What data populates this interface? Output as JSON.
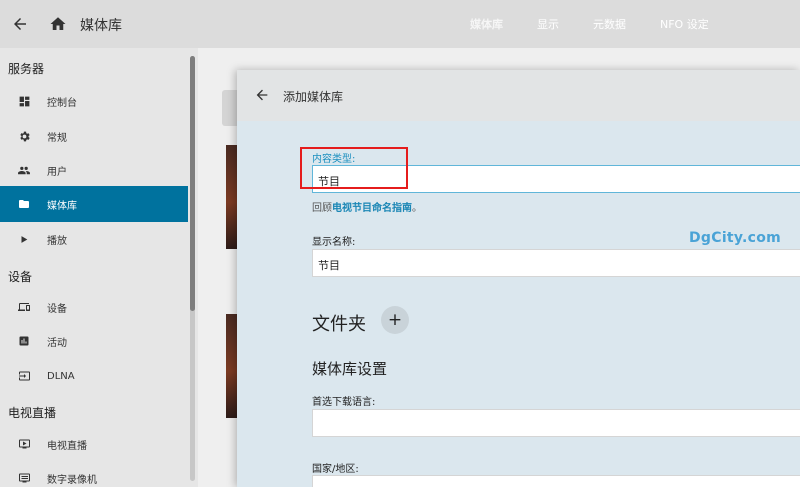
{
  "topbar": {
    "title": "媒体库",
    "tabs": [
      "媒体库",
      "显示",
      "元数据",
      "NFO 设定"
    ]
  },
  "sidebar": {
    "sections": [
      {
        "label": "服务器",
        "items": [
          {
            "label": "控制台",
            "icon": "dashboard-icon"
          },
          {
            "label": "常规",
            "icon": "gear-icon"
          },
          {
            "label": "用户",
            "icon": "people-icon"
          },
          {
            "label": "媒体库",
            "icon": "folder-icon",
            "active": true
          },
          {
            "label": "播放",
            "icon": "play-icon"
          }
        ]
      },
      {
        "label": "设备",
        "items": [
          {
            "label": "设备",
            "icon": "devices-icon"
          },
          {
            "label": "活动",
            "icon": "activity-icon"
          },
          {
            "label": "DLNA",
            "icon": "input-icon"
          }
        ]
      },
      {
        "label": "电视直播",
        "items": [
          {
            "label": "电视直播",
            "icon": "live-tv-icon"
          },
          {
            "label": "数字录像机",
            "icon": "dvr-icon"
          }
        ]
      }
    ]
  },
  "dialog": {
    "title": "添加媒体库",
    "content_type": {
      "label": "内容类型:",
      "value": "节目"
    },
    "helper": {
      "prefix": "回顾",
      "link": "电视节目命名指南",
      "suffix": "。"
    },
    "display_name": {
      "label": "显示名称:",
      "value": "节目"
    },
    "folders": {
      "title": "文件夹",
      "add": "+"
    },
    "library_settings": {
      "title": "媒体库设置"
    },
    "download_language": {
      "label": "首选下载语言:",
      "value": ""
    },
    "country": {
      "label": "国家/地区:",
      "value": ""
    }
  },
  "watermark": "DgCity.com",
  "colors": {
    "accent": "#00729e",
    "highlight": "#e51c1c",
    "link": "#1a86b5"
  }
}
